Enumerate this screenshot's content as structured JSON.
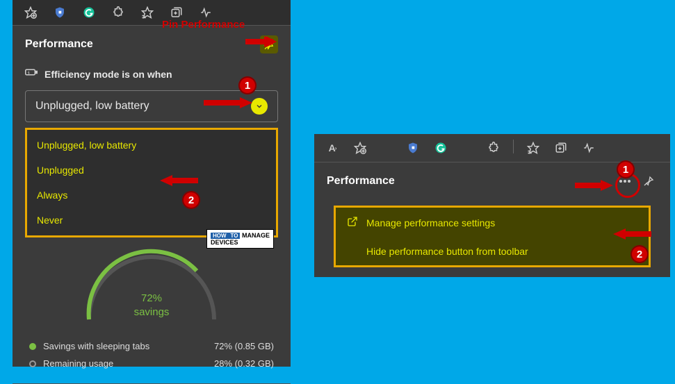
{
  "left": {
    "title": "Performance",
    "annotation_pin": "Pin Performance",
    "efficiency_label": "Efficiency mode is on when",
    "dropdown_selected": "Unplugged, low battery",
    "dropdown_options": [
      "Unplugged, low battery",
      "Unplugged",
      "Always",
      "Never"
    ],
    "gauge": {
      "percent": "72%",
      "label": "savings"
    },
    "stats": [
      {
        "label": "Savings with sleeping tabs",
        "value": "72% (0.85 GB)"
      },
      {
        "label": "Remaining usage",
        "value": "28% (0.32 GB)"
      }
    ]
  },
  "right": {
    "title": "Performance",
    "menu": [
      "Manage performance settings",
      "Hide performance button from toolbar"
    ]
  },
  "markers": {
    "one": "1",
    "two": "2"
  },
  "watermark": {
    "how": "HOW",
    "to": "TO",
    "manage": "MANAGE",
    "devices": "DEVICES"
  }
}
